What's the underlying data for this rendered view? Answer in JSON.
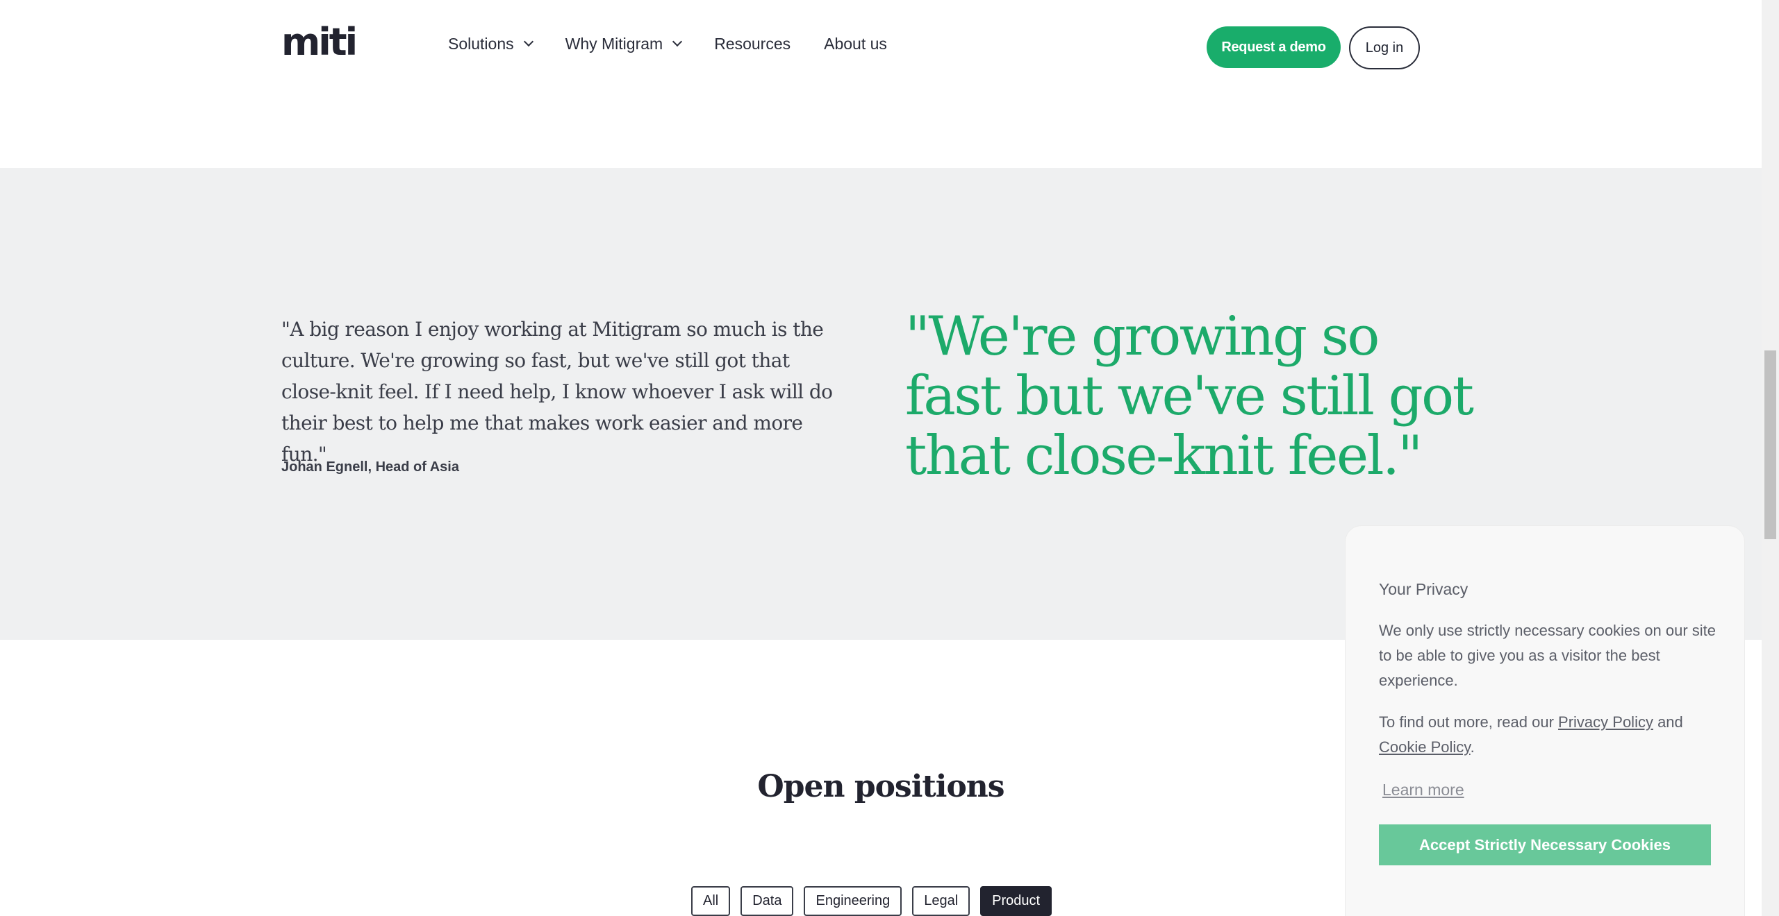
{
  "header": {
    "logo_text": "miti",
    "nav": [
      {
        "label": "Solutions",
        "has_dropdown": true
      },
      {
        "label": "Why Mitigram",
        "has_dropdown": true
      },
      {
        "label": "Resources",
        "has_dropdown": false
      },
      {
        "label": "About us",
        "has_dropdown": false
      }
    ],
    "demo_button": "Request a demo",
    "login_button": "Log in"
  },
  "testimonial": {
    "quote": "\"A big reason I enjoy working at Mitigram so much is the culture. We're growing so fast, but we've still got that close-knit feel. If I need help, I know whoever I ask will do their best to help me that makes work easier and more fun.\"",
    "author": "Johan Egnell, Head of Asia",
    "pull_quote": "\"We're growing so fast but we've still got that close-knit feel.\""
  },
  "positions": {
    "title": "Open positions",
    "filters": [
      {
        "label": "All",
        "active": false
      },
      {
        "label": "Data",
        "active": false
      },
      {
        "label": "Engineering",
        "active": false
      },
      {
        "label": "Legal",
        "active": false
      },
      {
        "label": "Product",
        "active": true
      }
    ]
  },
  "cookie": {
    "title": "Your Privacy",
    "text": "We only use strictly necessary cookies on our site to be able to give you as a visitor the best experience.",
    "text2_prefix": "To find out more, read our ",
    "privacy_link": "Privacy Policy",
    "text2_and": " and ",
    "cookie_link": "Cookie Policy",
    "text2_suffix": ".",
    "learn_more": "Learn more",
    "accept_button": "Accept Strictly Necessary Cookies"
  },
  "colors": {
    "brand_green": "#19ad6b",
    "quote_green": "#1caa6a",
    "section_gray": "#eff0f1",
    "accept_green": "#68c89a"
  }
}
